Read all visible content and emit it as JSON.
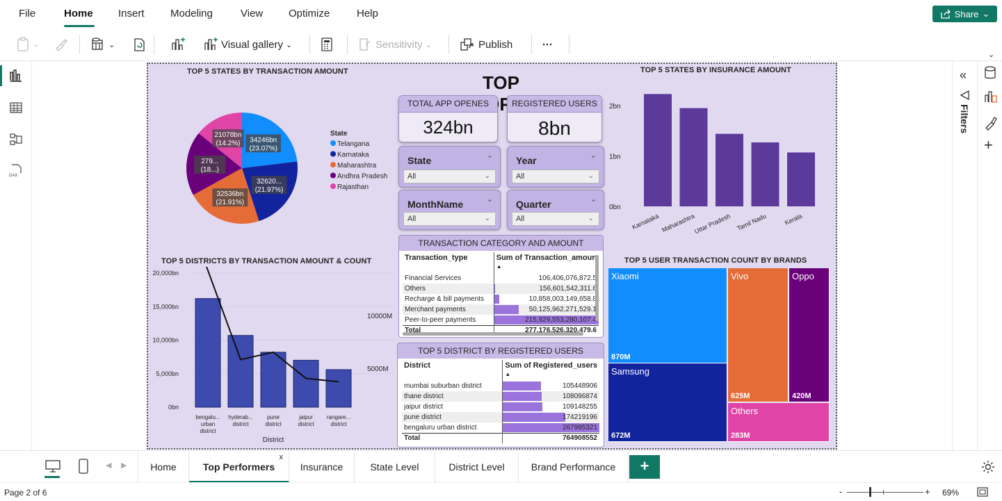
{
  "menu": {
    "items": [
      "File",
      "Home",
      "Insert",
      "Modeling",
      "View",
      "Optimize",
      "Help"
    ],
    "share_label": "Share"
  },
  "ribbon": {
    "visual_gallery_label": "Visual gallery",
    "sensitivity_label": "Sensitivity",
    "publish_label": "Publish",
    "more_label": "···"
  },
  "filters_label": "Filters",
  "report": {
    "title": "TOP PERFORMERS",
    "pie": {
      "title": "TOP 5 STATES BY TRANSACTION AMOUNT",
      "legend_title": "State",
      "colors": [
        "#118dff",
        "#12239e",
        "#e66c37",
        "#6b007b",
        "#e044a7"
      ],
      "slice_labels": [
        [
          "34246bn",
          "(23.07%)"
        ],
        [
          "32620...",
          "(21.97%)"
        ],
        [
          "32536bn",
          "(21.91%)"
        ],
        [
          "279...",
          "(18...)"
        ],
        [
          "21078bn",
          "(14.2%)"
        ]
      ]
    },
    "cards": {
      "app_opens_label": "TOTAL APP OPENES",
      "app_opens_value": "324bn",
      "users_label": "REGISTERED USERS",
      "users_value": "8bn"
    },
    "slicers": [
      {
        "label": "State",
        "value": "All"
      },
      {
        "label": "Year",
        "value": "All"
      },
      {
        "label": "MonthName",
        "value": "All"
      },
      {
        "label": "Quarter",
        "value": "All"
      }
    ],
    "insurance_chart_title": "TOP 5 STATES BY INSURANCE AMOUNT",
    "district_combo_title": "TOP 5 DISTRICTS BY TRANSACTION AMOUNT & COUNT",
    "district_combo_xlabel": "District",
    "secondary_ticks": [
      "10000M",
      "5000M"
    ],
    "category_table": {
      "title": "TRANSACTION CATEGORY AND AMOUNT",
      "headers": [
        "Transaction_type",
        "Sum of Transaction_amoun"
      ],
      "rows": [
        [
          "Financial Services",
          "106,406,076,872.5"
        ],
        [
          "Others",
          "156,601,542,311.6"
        ],
        [
          "Recharge & bill payments",
          "10,858,003,149,658.8"
        ],
        [
          "Merchant payments",
          "50,125,962,271,529.1"
        ],
        [
          "Peer-to-peer payments",
          "215,929,553,280,107.4"
        ]
      ],
      "row_fracs": [
        0.0005,
        0.0007,
        0.05,
        0.232,
        1.0
      ],
      "total": [
        "Total",
        "277,176,526,320,479.6"
      ]
    },
    "users_table": {
      "title": "TOP 5 DISTRICT BY REGISTERED USERS",
      "headers": [
        "District",
        "Sum of Registered_users"
      ],
      "rows": [
        [
          "mumbai suburban district",
          "105448906"
        ],
        [
          "thane district",
          "108096874"
        ],
        [
          "jaipur district",
          "109148255"
        ],
        [
          "pune district",
          "174219196"
        ],
        [
          "bengaluru urban district",
          "267995321"
        ]
      ],
      "row_fracs": [
        0.393,
        0.403,
        0.407,
        0.65,
        1.0
      ],
      "total": [
        "Total",
        "764908552"
      ]
    },
    "treemap": {
      "title": "TOP 5 USER TRANSACTION COUNT BY BRANDS",
      "tiles": [
        {
          "name": "Xiaomi",
          "value": "870M",
          "color": "#118dff"
        },
        {
          "name": "Samsung",
          "value": "672M",
          "color": "#12239e"
        },
        {
          "name": "Vivo",
          "value": "625M",
          "color": "#e66c37"
        },
        {
          "name": "Oppo",
          "value": "420M",
          "color": "#6b007b"
        },
        {
          "name": "Others",
          "value": "283M",
          "color": "#e044a7"
        }
      ]
    }
  },
  "chart_data": [
    {
      "type": "pie",
      "title": "TOP 5 STATES BY TRANSACTION AMOUNT",
      "legend_title": "State",
      "categories": [
        "Telangana",
        "Karnataka",
        "Maharashtra",
        "Andhra Pradesh",
        "Rajasthan"
      ],
      "values": [
        34246,
        32620,
        32536,
        27900,
        21078
      ],
      "unit": "bn"
    },
    {
      "type": "bar",
      "title": "TOP 5 STATES BY INSURANCE AMOUNT",
      "categories": [
        "Karnataka",
        "Maharashtra",
        "Uttar Pradesh",
        "Tamil Nadu",
        "Kerala"
      ],
      "values": [
        2.23,
        1.95,
        1.44,
        1.27,
        1.07
      ],
      "unit": "bn",
      "ylim": [
        0,
        2
      ],
      "yticks": [
        "2bn",
        "1bn",
        "0bn"
      ]
    },
    {
      "type": "bar",
      "title": "TOP 5 DISTRICTS BY TRANSACTION AMOUNT & COUNT",
      "categories": [
        "bengalu... urban district",
        "hyderab... district",
        "pune district",
        "jaipur district",
        "rangare... district"
      ],
      "xlabel": "District",
      "series": [
        {
          "values": [
            16200,
            10700,
            8200,
            7000,
            5600
          ]
        },
        {
          "type": "line",
          "values": [
            13700,
            7100,
            8200,
            4300,
            3800
          ]
        }
      ],
      "ylim": [
        0,
        20000
      ],
      "yticks": [
        "20,000bn",
        "15,000bn",
        "10,000bn",
        "5,000bn",
        "0bn"
      ],
      "y2_ticks": [
        "10000M",
        "5000M"
      ]
    }
  ],
  "page_tabs": [
    "Home",
    "Top Performers",
    "Insurance",
    "State Level",
    "District Level",
    "Brand Performance"
  ],
  "tab_close_label": "x",
  "add_page_label": "+",
  "status": {
    "page": "Page 2 of 6",
    "zoom": "69%",
    "zoom_minus": "-",
    "zoom_plus": "+"
  }
}
